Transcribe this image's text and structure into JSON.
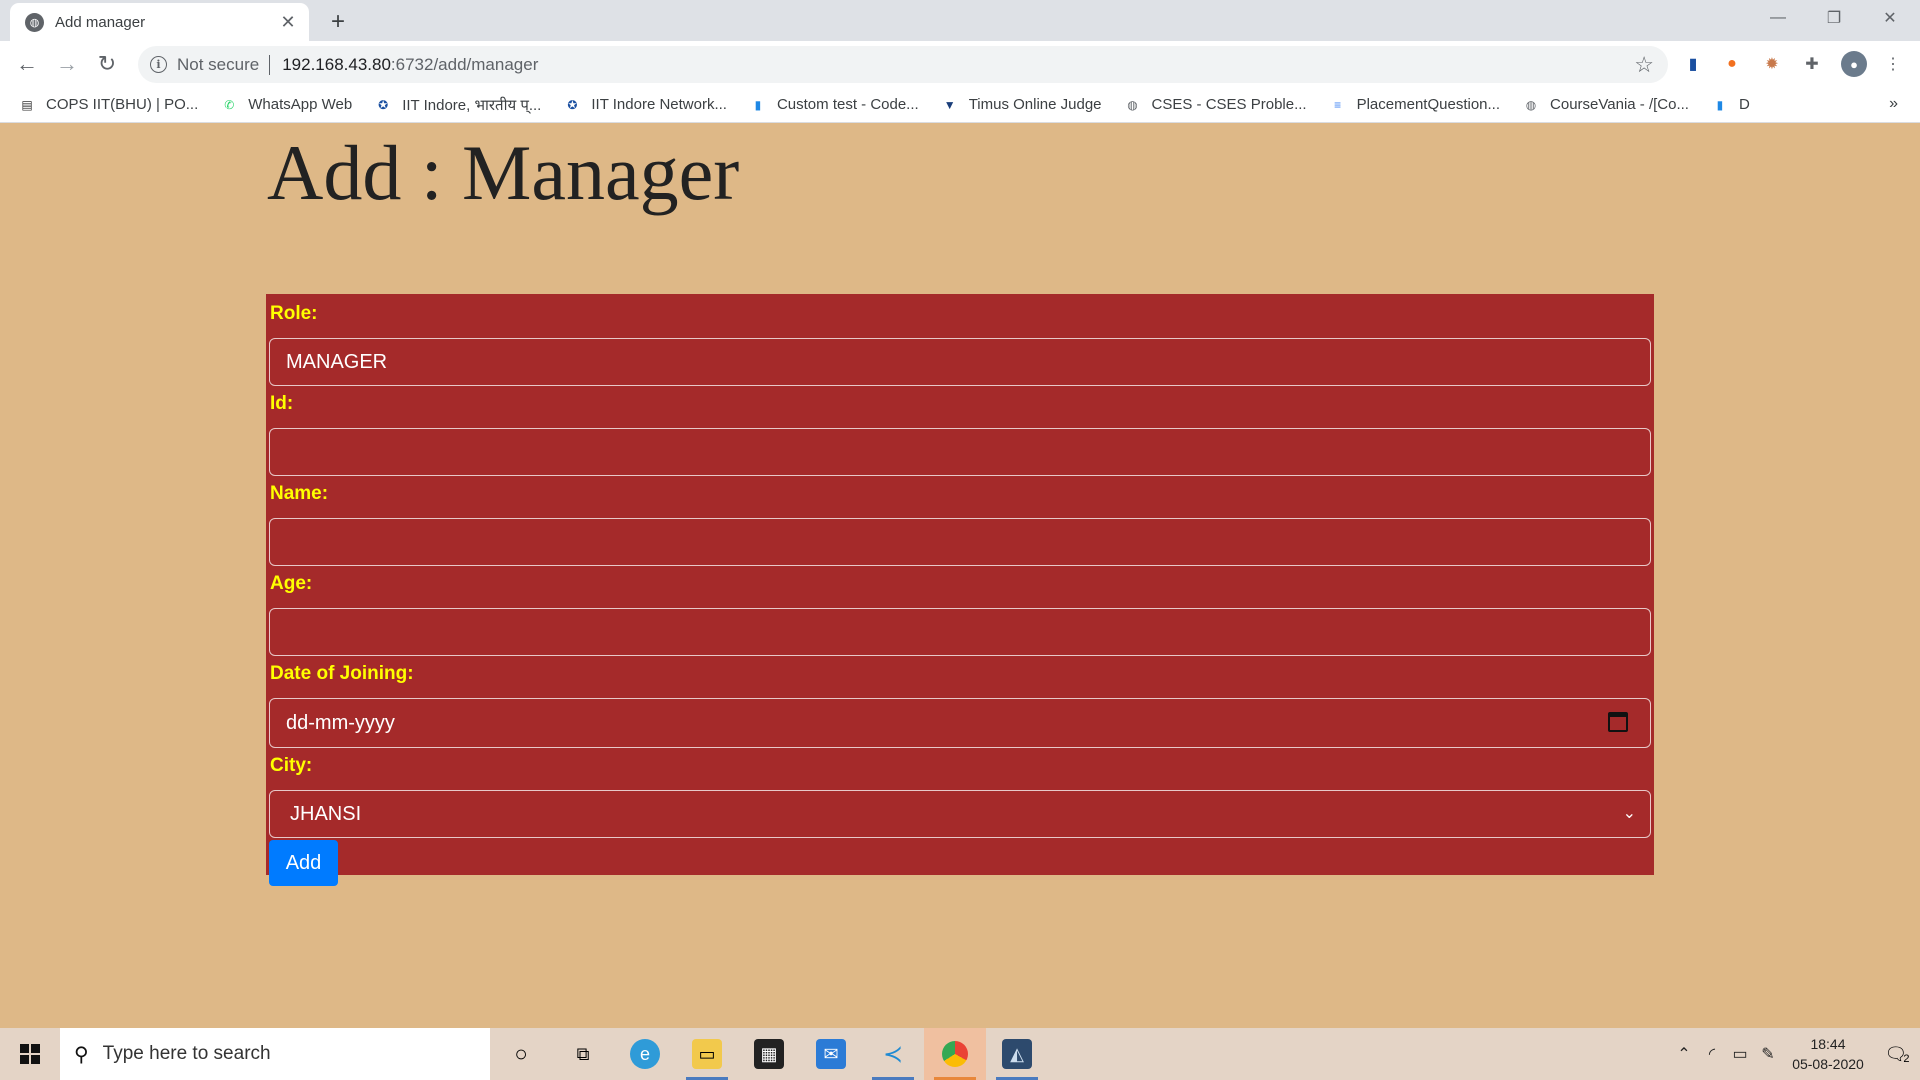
{
  "browser": {
    "tab": {
      "title": "Add manager",
      "favicon": "globe-icon"
    },
    "toolbar": {
      "security": "Not secure",
      "url_host": "192.168.43.80",
      "url_rest": ":6732/add/manager"
    },
    "bookmarks": [
      {
        "label": "COPS IIT(BHU) | PO...",
        "icon": "cops-icon",
        "color": "#333333"
      },
      {
        "label": "WhatsApp Web",
        "icon": "whatsapp-icon",
        "color": "#25d366"
      },
      {
        "label": "IIT Indore, भारतीय प्...",
        "icon": "iit-indore-icon",
        "color": "#1a4fa0"
      },
      {
        "label": "IIT Indore Network...",
        "icon": "iit-indore-icon",
        "color": "#1a4fa0"
      },
      {
        "label": "Custom test - Code...",
        "icon": "codeforces-icon",
        "color": "#1e88e5"
      },
      {
        "label": "Timus Online Judge",
        "icon": "timus-icon",
        "color": "#1a3e7a"
      },
      {
        "label": "CSES - CSES Proble...",
        "icon": "globe-icon",
        "color": "#5f6368"
      },
      {
        "label": "PlacementQuestion...",
        "icon": "docs-icon",
        "color": "#4285f4"
      },
      {
        "label": "CourseVania - /[Co...",
        "icon": "globe-icon",
        "color": "#5f6368"
      },
      {
        "label": "D",
        "icon": "codeforces-icon",
        "color": "#1e88e5"
      }
    ]
  },
  "page": {
    "title": "Add : Manager",
    "form": {
      "role_label": "Role:",
      "role_value": "MANAGER",
      "id_label": "Id:",
      "name_label": "Name:",
      "age_label": "Age:",
      "doj_label": "Date of Joining:",
      "doj_placeholder": "dd-mm-yyyy",
      "city_label": "City:",
      "city_value": "JHANSI",
      "add_label": "Add"
    },
    "colors": {
      "background": "#deb887",
      "form": "#a52a2a",
      "label": "#ffff00",
      "button": "#007bff"
    }
  },
  "taskbar": {
    "search_placeholder": "Type here to search",
    "time": "18:44",
    "date": "05-08-2020",
    "notification_count": "2",
    "apps": [
      "cortana-icon",
      "task-view-icon",
      "edge-icon",
      "file-explorer-icon",
      "store-icon",
      "mail-icon",
      "vscode-icon",
      "chrome-icon",
      "mysql-workbench-icon"
    ]
  }
}
